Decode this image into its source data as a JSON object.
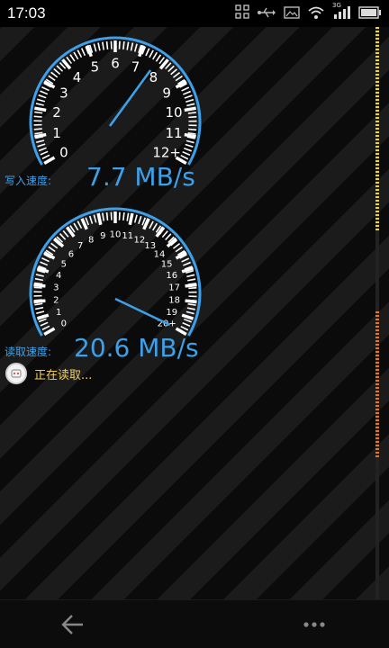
{
  "status_bar": {
    "time": "17:03",
    "icons": [
      "screenshot-icon",
      "usb-icon",
      "image-icon",
      "wifi-icon",
      "signal-icon",
      "battery-icon"
    ],
    "network_label": "3G"
  },
  "write_gauge": {
    "label": "写入速度:",
    "value_text": "7.7 MB/s",
    "speed": 7.7,
    "scale_max": 12,
    "ticks": [
      "0",
      "1",
      "2",
      "3",
      "4",
      "5",
      "6",
      "7",
      "8",
      "9",
      "10",
      "11",
      "12+"
    ]
  },
  "read_gauge": {
    "label": "读取速度:",
    "value_text": "20.6 MB/s",
    "speed": 20.6,
    "scale_max": 20,
    "ticks": [
      "0",
      "1",
      "2",
      "3",
      "4",
      "5",
      "6",
      "7",
      "8",
      "9",
      "10",
      "11",
      "12",
      "13",
      "14",
      "15",
      "16",
      "17",
      "18",
      "19",
      "20+"
    ]
  },
  "status_message": "正在读取...",
  "colors": {
    "accent": "#3da0e8",
    "status_text": "#f0d060",
    "scale_top": "#e8d24a",
    "scale_bottom": "#e8742a"
  }
}
